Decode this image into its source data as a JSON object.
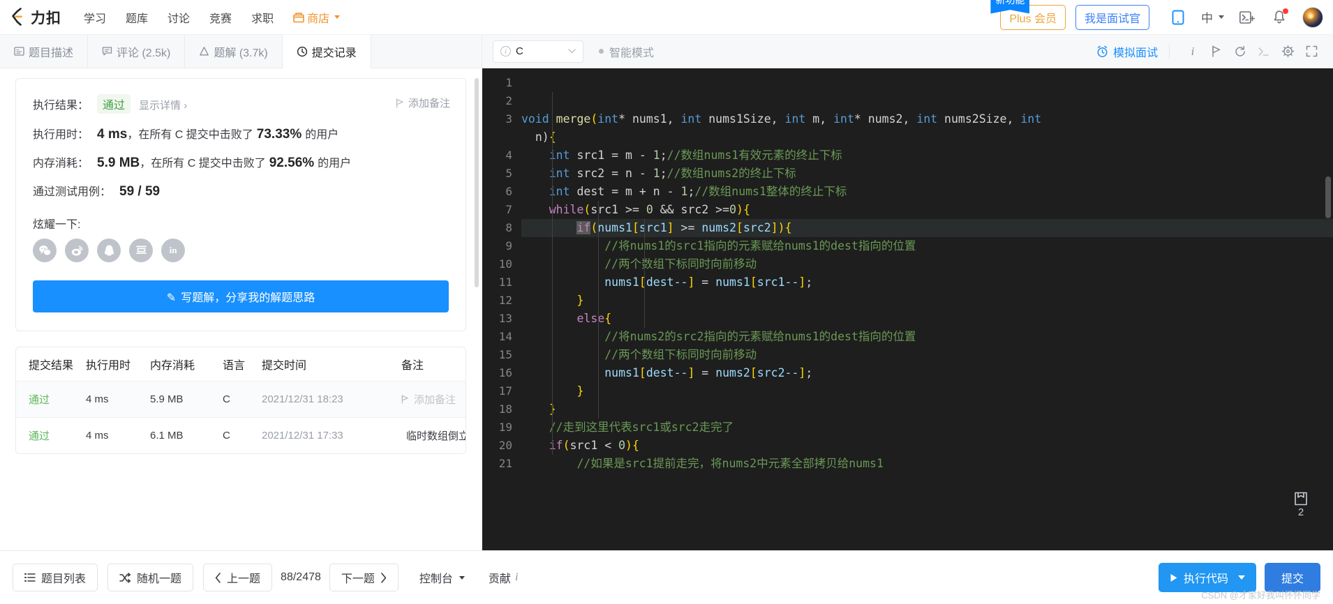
{
  "nav": {
    "brand": "力扣",
    "links": [
      "学习",
      "题库",
      "讨论",
      "竞赛",
      "求职"
    ],
    "shop": "商店",
    "new_badge": "新功能",
    "plus": "Plus 会员",
    "interviewer": "我是面试官",
    "lang": "中",
    "accent_blue": "#1890ff",
    "accent_orange": "#f0a33c"
  },
  "tabs": [
    {
      "label": "题目描述",
      "icon": "description-icon",
      "active": false
    },
    {
      "label": "评论 (2.5k)",
      "icon": "comment-icon",
      "active": false
    },
    {
      "label": "题解 (3.7k)",
      "icon": "solution-icon",
      "active": false
    },
    {
      "label": "提交记录",
      "icon": "clock-icon",
      "active": true
    }
  ],
  "result": {
    "result_label": "执行结果：",
    "status": "通过",
    "detail_link": "显示详情",
    "add_note": "添加备注",
    "runtime_label": "执行用时：",
    "runtime_value": "4 ms",
    "runtime_text_before": "，在所有 C 提交中击败了",
    "runtime_percent": "73.33%",
    "runtime_text_after": "的用户",
    "memory_label": "内存消耗：",
    "memory_value": "5.9 MB",
    "memory_text_before": "，在所有 C 提交中击败了",
    "memory_percent": "92.56%",
    "memory_text_after": "的用户",
    "testcase_label": "通过测试用例：",
    "testcase_value": "59 / 59",
    "share_label": "炫耀一下:",
    "share_icons": [
      "wechat-icon",
      "weibo-icon",
      "qq-icon",
      "douban-icon",
      "linkedin-icon"
    ],
    "write_button": "写题解，分享我的解题思路"
  },
  "table": {
    "headers": [
      "提交结果",
      "执行用时",
      "内存消耗",
      "语言",
      "提交时间",
      "备注"
    ],
    "rows": [
      {
        "status": "通过",
        "runtime": "4 ms",
        "memory": "5.9 MB",
        "lang": "C",
        "time": "2021/12/31 18:23",
        "note": "添加备注",
        "note_empty": true,
        "flag": "grey"
      },
      {
        "status": "通过",
        "runtime": "4 ms",
        "memory": "6.1 MB",
        "lang": "C",
        "time": "2021/12/31 17:33",
        "note": "临时数组倒立刖",
        "note_empty": false,
        "flag": "orange"
      }
    ]
  },
  "editor_toolbar": {
    "language": "C",
    "smart_mode": "智能模式",
    "mock_interview": "模拟面试",
    "icons": [
      "info-icon",
      "flag-icon",
      "reset-icon",
      "console-icon",
      "settings-icon",
      "fullscreen-icon"
    ]
  },
  "code": {
    "save_count": "2",
    "lines": [
      {
        "n": "1",
        "segs": []
      },
      {
        "n": "2",
        "segs": []
      },
      {
        "n": "3",
        "segs": [
          {
            "t": "void ",
            "c": "tok-type"
          },
          {
            "t": "merge",
            "c": "tok-fn"
          },
          {
            "t": "(",
            "c": "tok-punc"
          },
          {
            "t": "int",
            "c": "tok-type"
          },
          {
            "t": "* nums1, ",
            "c": "tok-op"
          },
          {
            "t": "int",
            "c": "tok-type"
          },
          {
            "t": " nums1Size, ",
            "c": "tok-op"
          },
          {
            "t": "int",
            "c": "tok-type"
          },
          {
            "t": " m, ",
            "c": "tok-op"
          },
          {
            "t": "int",
            "c": "tok-type"
          },
          {
            "t": "* nums2, ",
            "c": "tok-op"
          },
          {
            "t": "int",
            "c": "tok-type"
          },
          {
            "t": " nums2Size, ",
            "c": "tok-op"
          },
          {
            "t": "int",
            "c": "tok-type"
          }
        ]
      },
      {
        "n": "",
        "cont": true,
        "segs": [
          {
            "t": "  n)",
            "c": "tok-op"
          },
          {
            "t": "{",
            "c": "tok-punc"
          }
        ]
      },
      {
        "n": "4",
        "segs": [
          {
            "t": "    ",
            "c": "tok-op"
          },
          {
            "t": "int",
            "c": "tok-type"
          },
          {
            "t": " src1 = m - ",
            "c": "tok-op"
          },
          {
            "t": "1",
            "c": "tok-num"
          },
          {
            "t": ";",
            "c": "tok-op"
          },
          {
            "t": "//数组nums1有效元素的终止下标",
            "c": "tok-cmt"
          }
        ]
      },
      {
        "n": "5",
        "segs": [
          {
            "t": "    ",
            "c": "tok-op"
          },
          {
            "t": "int",
            "c": "tok-type"
          },
          {
            "t": " src2 = n - ",
            "c": "tok-op"
          },
          {
            "t": "1",
            "c": "tok-num"
          },
          {
            "t": ";",
            "c": "tok-op"
          },
          {
            "t": "//数组nums2的终止下标",
            "c": "tok-cmt"
          }
        ]
      },
      {
        "n": "6",
        "segs": [
          {
            "t": "    ",
            "c": "tok-op"
          },
          {
            "t": "int",
            "c": "tok-type"
          },
          {
            "t": " dest = m + n - ",
            "c": "tok-op"
          },
          {
            "t": "1",
            "c": "tok-num"
          },
          {
            "t": ";",
            "c": "tok-op"
          },
          {
            "t": "//数组nums1整体的终止下标",
            "c": "tok-cmt"
          }
        ]
      },
      {
        "n": "7",
        "segs": [
          {
            "t": "    ",
            "c": "tok-op"
          },
          {
            "t": "while",
            "c": "tok-kw"
          },
          {
            "t": "(",
            "c": "tok-punc"
          },
          {
            "t": "src1 >= ",
            "c": "tok-op"
          },
          {
            "t": "0",
            "c": "tok-num"
          },
          {
            "t": " && src2 >=",
            "c": "tok-op"
          },
          {
            "t": "0",
            "c": "tok-num"
          },
          {
            "t": ")",
            "c": "tok-punc"
          },
          {
            "t": "{",
            "c": "tok-punc"
          }
        ]
      },
      {
        "n": "8",
        "hl": true,
        "segs": [
          {
            "t": "        ",
            "c": "tok-op"
          },
          {
            "t": "if",
            "c": "cursor-blk"
          },
          {
            "t": "(",
            "c": "tok-punc"
          },
          {
            "t": "nums1",
            "c": "tok-var"
          },
          {
            "t": "[",
            "c": "tok-punc"
          },
          {
            "t": "src1",
            "c": "tok-var"
          },
          {
            "t": "]",
            "c": "tok-punc"
          },
          {
            "t": " >= ",
            "c": "tok-op"
          },
          {
            "t": "nums2",
            "c": "tok-var"
          },
          {
            "t": "[",
            "c": "tok-punc"
          },
          {
            "t": "src2",
            "c": "tok-var"
          },
          {
            "t": "]",
            "c": "tok-punc"
          },
          {
            "t": ")",
            "c": "tok-punc"
          },
          {
            "t": "{",
            "c": "tok-punc"
          }
        ]
      },
      {
        "n": "9",
        "segs": [
          {
            "t": "            //将nums1的src1指向的元素赋给nums1的dest指向的位置",
            "c": "tok-cmt"
          }
        ]
      },
      {
        "n": "10",
        "segs": [
          {
            "t": "            //两个数组下标同时向前移动",
            "c": "tok-cmt"
          }
        ]
      },
      {
        "n": "11",
        "segs": [
          {
            "t": "            ",
            "c": "tok-op"
          },
          {
            "t": "nums1",
            "c": "tok-var"
          },
          {
            "t": "[",
            "c": "tok-punc"
          },
          {
            "t": "dest--",
            "c": "tok-var"
          },
          {
            "t": "]",
            "c": "tok-punc"
          },
          {
            "t": " = ",
            "c": "tok-op"
          },
          {
            "t": "nums1",
            "c": "tok-var"
          },
          {
            "t": "[",
            "c": "tok-punc"
          },
          {
            "t": "src1--",
            "c": "tok-var"
          },
          {
            "t": "]",
            "c": "tok-punc"
          },
          {
            "t": ";",
            "c": "tok-op"
          }
        ]
      },
      {
        "n": "12",
        "segs": [
          {
            "t": "        ",
            "c": "tok-op"
          },
          {
            "t": "}",
            "c": "tok-punc"
          }
        ]
      },
      {
        "n": "13",
        "segs": [
          {
            "t": "        ",
            "c": "tok-op"
          },
          {
            "t": "else",
            "c": "tok-kw"
          },
          {
            "t": "{",
            "c": "tok-punc"
          }
        ]
      },
      {
        "n": "14",
        "segs": [
          {
            "t": "            //将nums2的src2指向的元素赋给nums1的dest指向的位置",
            "c": "tok-cmt"
          }
        ]
      },
      {
        "n": "15",
        "segs": [
          {
            "t": "            //两个数组下标同时向前移动",
            "c": "tok-cmt"
          }
        ]
      },
      {
        "n": "16",
        "segs": [
          {
            "t": "            ",
            "c": "tok-op"
          },
          {
            "t": "nums1",
            "c": "tok-var"
          },
          {
            "t": "[",
            "c": "tok-punc"
          },
          {
            "t": "dest--",
            "c": "tok-var"
          },
          {
            "t": "]",
            "c": "tok-punc"
          },
          {
            "t": " = ",
            "c": "tok-op"
          },
          {
            "t": "nums2",
            "c": "tok-var"
          },
          {
            "t": "[",
            "c": "tok-punc"
          },
          {
            "t": "src2--",
            "c": "tok-var"
          },
          {
            "t": "]",
            "c": "tok-punc"
          },
          {
            "t": ";",
            "c": "tok-op"
          }
        ]
      },
      {
        "n": "17",
        "segs": [
          {
            "t": "        ",
            "c": "tok-op"
          },
          {
            "t": "}",
            "c": "tok-punc"
          }
        ]
      },
      {
        "n": "18",
        "segs": [
          {
            "t": "    ",
            "c": "tok-op"
          },
          {
            "t": "}",
            "c": "tok-punc"
          }
        ]
      },
      {
        "n": "19",
        "segs": [
          {
            "t": "    //走到这里代表src1或src2走完了",
            "c": "tok-cmt"
          }
        ]
      },
      {
        "n": "20",
        "segs": [
          {
            "t": "    ",
            "c": "tok-op"
          },
          {
            "t": "if",
            "c": "tok-kw"
          },
          {
            "t": "(",
            "c": "tok-punc"
          },
          {
            "t": "src1 < ",
            "c": "tok-op"
          },
          {
            "t": "0",
            "c": "tok-num"
          },
          {
            "t": ")",
            "c": "tok-punc"
          },
          {
            "t": "{",
            "c": "tok-punc"
          }
        ]
      },
      {
        "n": "21",
        "segs": [
          {
            "t": "        //如果是src1提前走完，将nums2中元素全部拷贝给nums1",
            "c": "tok-cmt"
          }
        ]
      }
    ]
  },
  "footer": {
    "problem_list": "题目列表",
    "random": "随机一题",
    "prev": "上一题",
    "page_count": "88/2478",
    "next": "下一题",
    "console": "控制台",
    "contribute": "贡献",
    "run": "执行代码",
    "submit": "提交",
    "watermark": "CSDN @才家好我叫怀怀同学"
  }
}
